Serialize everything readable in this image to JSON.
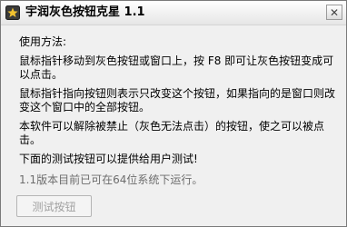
{
  "window": {
    "title": "宇润灰色按钮克星 1.1",
    "close_glyph": "✕",
    "icon": "app-star-icon"
  },
  "content": {
    "heading": "使用方法:",
    "paragraph1": "鼠标指针移动到灰色按钮或窗口上，按 F8 即可让灰色按钮变成可以点击。",
    "paragraph2": "鼠标指针指向按钮则表示只改变这个按钮，如果指向的是窗口则改变这个窗口中的全部按钮。",
    "paragraph3": "本软件可以解除被禁止（灰色无法点击）的按钮，使之可以被点击。",
    "paragraph4": "下面的测试按钮可以提供给用户测试!",
    "version_note": "1.1版本目前已可在64位系统下运行。"
  },
  "test_button": {
    "label": "测试按钮",
    "state": "disabled"
  },
  "colors": {
    "window_bg": "#f0f0f0",
    "disabled_text": "#a0a0a0",
    "version_text": "#6d6d6d"
  }
}
